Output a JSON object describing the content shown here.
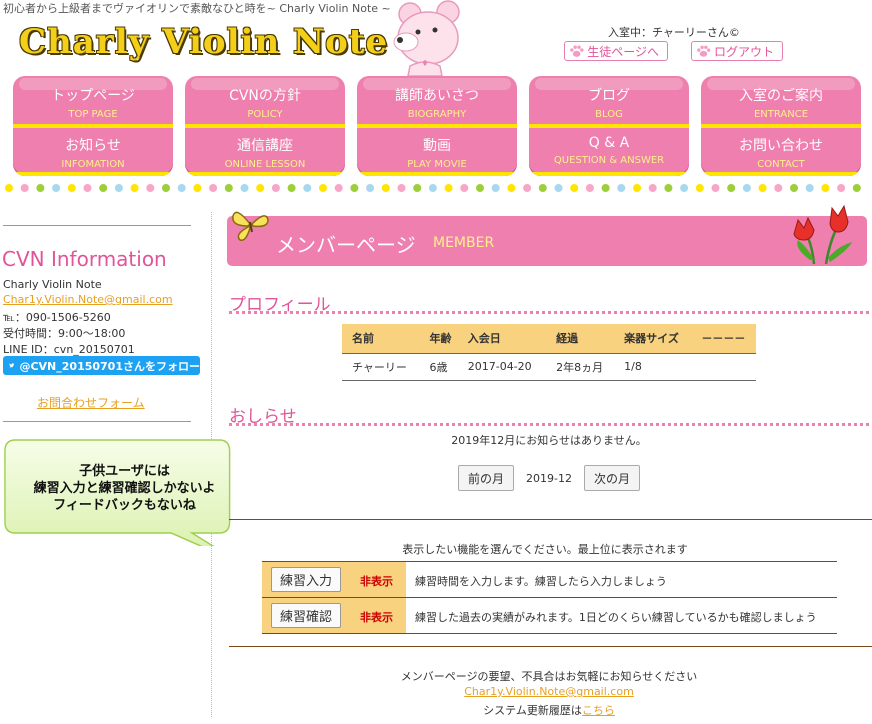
{
  "header": {
    "tagline": "初心者から上級者までヴァイオリンで素敵なひと時を~ Charly Violin Note ~",
    "logo": "Charly Violin Note",
    "login_status": "入室中：チャーリーさん©",
    "student_page_label": "生徒ページへ",
    "logout_label": "ログアウト"
  },
  "nav": [
    {
      "jp": "トップページ",
      "en": "TOP PAGE"
    },
    {
      "jp": "CVNの方針",
      "en": "POLICY"
    },
    {
      "jp": "講師あいさつ",
      "en": "BIOGRAPHY"
    },
    {
      "jp": "ブログ",
      "en": "BLOG"
    },
    {
      "jp": "入室のご案内",
      "en": "ENTRANCE"
    },
    {
      "jp": "お知らせ",
      "en": "INFOMATION"
    },
    {
      "jp": "通信講座",
      "en": "ONLINE LESSON"
    },
    {
      "jp": "動画",
      "en": "PLAY MOVIE"
    },
    {
      "jp": "Q & A",
      "en": "QUESTION & ANSWER"
    },
    {
      "jp": "お問い合わせ",
      "en": "CONTACT"
    }
  ],
  "sidebar": {
    "title": "CVN Information",
    "name": "Charly Violin Note",
    "email": "Char1y.Violin.Note@gmail.com",
    "tel": "℡：090-1506-5260",
    "hours": "受付時間：9:00～18:00",
    "line": "LINE ID：cvn_20150701",
    "twitter_label": "@CVN_20150701さんをフォロー",
    "contact_form": "お問合わせフォーム"
  },
  "bubble": {
    "line1": "子供ユーザには",
    "line2": "練習入力と練習確認しかないよ",
    "line3": "フィードバックもないね"
  },
  "member": {
    "title": "メンバーページ",
    "title_en": "MEMBER"
  },
  "profile": {
    "section_title": "プロフィール",
    "headers": [
      "名前",
      "年齢",
      "入会日",
      "経過",
      "楽器サイズ",
      "－－－－"
    ],
    "row": [
      "チャーリー",
      "6歳",
      "2017-04-20",
      "2年8ヵ月",
      "1/8",
      ""
    ]
  },
  "notice": {
    "section_title": "おしらせ",
    "empty_text": "2019年12月にお知らせはありません。",
    "prev_label": "前の月",
    "current_month": "2019-12",
    "next_label": "次の月"
  },
  "functions": {
    "prompt": "表示したい機能を選んでください。最上位に表示されます",
    "items": [
      {
        "button": "練習入力",
        "status": "非表示",
        "desc": "練習時間を入力します。練習したら入力しましょう"
      },
      {
        "button": "練習確認",
        "status": "非表示",
        "desc": "練習した過去の実績がみれます。1日どのくらい練習しているかも確認しましょう"
      }
    ]
  },
  "footer": {
    "request": "メンバーページの要望、不具合はお気軽にお知らせください",
    "email": "Char1y.Violin.Note@gmail.com",
    "history_prefix": "システム更新履歴は",
    "history_link": "こちら"
  },
  "colors": {
    "pink": "#ee7fae",
    "pink_text": "#e0559a",
    "yellow": "#ffe500",
    "table_header": "#f8d27e",
    "twitter": "#1da1f2",
    "bubble_fill": "#e6f7c2"
  }
}
